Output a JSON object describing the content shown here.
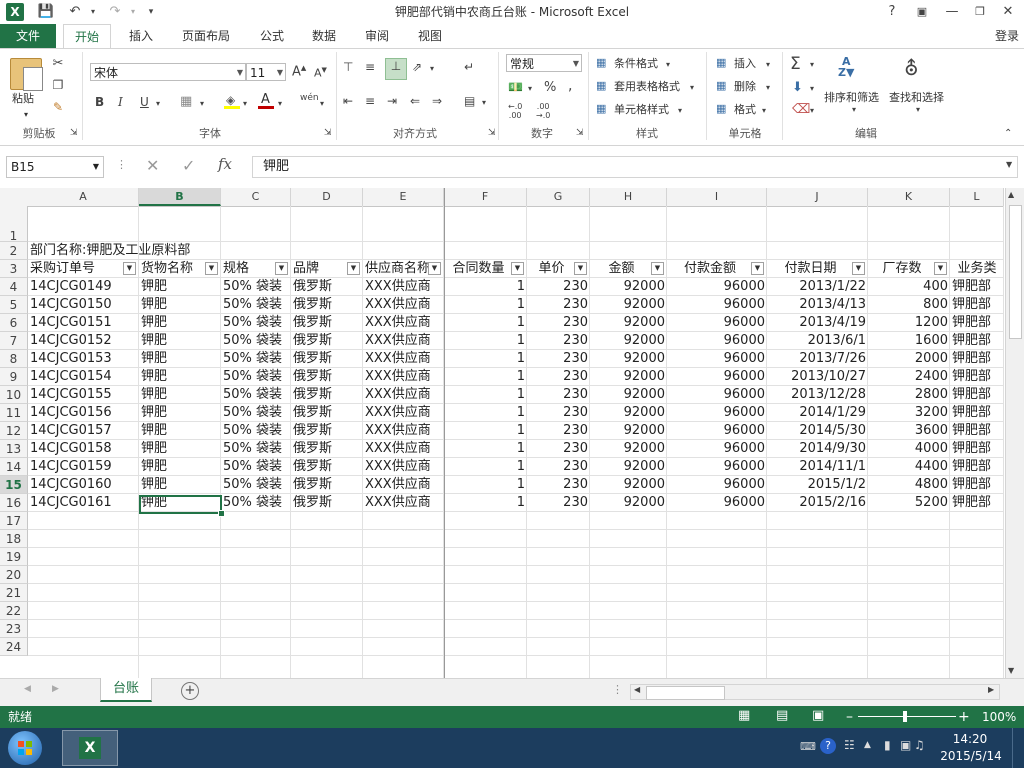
{
  "window": {
    "title": "钾肥部代销中农商丘台账 - Microsoft Excel",
    "help": "?",
    "login": "登录"
  },
  "tabs": [
    {
      "label": "文件"
    },
    {
      "label": "开始"
    },
    {
      "label": "插入"
    },
    {
      "label": "页面布局"
    },
    {
      "label": "公式"
    },
    {
      "label": "数据"
    },
    {
      "label": "审阅"
    },
    {
      "label": "视图"
    }
  ],
  "ribbon": {
    "clipboard": {
      "label": "剪贴板",
      "paste": "粘贴"
    },
    "font": {
      "label": "字体",
      "name": "宋体",
      "size": "11",
      "bold": "B",
      "italic": "I",
      "underline": "U",
      "wen": "wén"
    },
    "alignment": {
      "label": "对齐方式"
    },
    "number": {
      "label": "数字",
      "format": "常规"
    },
    "styles": {
      "label": "样式",
      "conditional": "条件格式",
      "table": "套用表格格式",
      "cell_styles": "单元格样式"
    },
    "cells": {
      "label": "单元格",
      "insert": "插入",
      "delete": "删除",
      "format": "格式"
    },
    "editing": {
      "label": "编辑",
      "sort_filter": "排序和筛选",
      "find_select": "查找和选择"
    }
  },
  "formula_bar": {
    "name_box": "B15",
    "fx": "fx",
    "content": "钾肥"
  },
  "columns": [
    "A",
    "B",
    "C",
    "D",
    "E",
    "F",
    "G",
    "H",
    "I",
    "J",
    "K",
    "L"
  ],
  "row_numbers": [
    "1",
    "2",
    "3",
    "4",
    "5",
    "6",
    "7",
    "8",
    "9",
    "10",
    "11",
    "12",
    "13",
    "14",
    "15",
    "16",
    "17",
    "18",
    "19",
    "20",
    "21",
    "22",
    "23",
    "24"
  ],
  "dept_label": "部门名称:钾肥及工业原料部",
  "headers": [
    "采购订单号",
    "货物名称",
    "规格",
    "品牌",
    "供应商名称",
    "合同数量",
    "单价",
    "金额",
    "付款金额",
    "付款日期",
    "厂存数",
    "业务类"
  ],
  "rows": [
    [
      "14CJCG0149",
      "钾肥",
      "50% 袋装",
      "俄罗斯",
      "XXX供应商",
      "1",
      "230",
      "92000",
      "96000",
      "2013/1/22",
      "400",
      "钾肥部"
    ],
    [
      "14CJCG0150",
      "钾肥",
      "50% 袋装",
      "俄罗斯",
      "XXX供应商",
      "1",
      "230",
      "92000",
      "96000",
      "2013/4/13",
      "800",
      "钾肥部"
    ],
    [
      "14CJCG0151",
      "钾肥",
      "50% 袋装",
      "俄罗斯",
      "XXX供应商",
      "1",
      "230",
      "92000",
      "96000",
      "2013/4/19",
      "1200",
      "钾肥部"
    ],
    [
      "14CJCG0152",
      "钾肥",
      "50% 袋装",
      "俄罗斯",
      "XXX供应商",
      "1",
      "230",
      "92000",
      "96000",
      "2013/6/1",
      "1600",
      "钾肥部"
    ],
    [
      "14CJCG0153",
      "钾肥",
      "50% 袋装",
      "俄罗斯",
      "XXX供应商",
      "1",
      "230",
      "92000",
      "96000",
      "2013/7/26",
      "2000",
      "钾肥部"
    ],
    [
      "14CJCG0154",
      "钾肥",
      "50% 袋装",
      "俄罗斯",
      "XXX供应商",
      "1",
      "230",
      "92000",
      "96000",
      "2013/10/27",
      "2400",
      "钾肥部"
    ],
    [
      "14CJCG0155",
      "钾肥",
      "50% 袋装",
      "俄罗斯",
      "XXX供应商",
      "1",
      "230",
      "92000",
      "96000",
      "2013/12/28",
      "2800",
      "钾肥部"
    ],
    [
      "14CJCG0156",
      "钾肥",
      "50% 袋装",
      "俄罗斯",
      "XXX供应商",
      "1",
      "230",
      "92000",
      "96000",
      "2014/1/29",
      "3200",
      "钾肥部"
    ],
    [
      "14CJCG0157",
      "钾肥",
      "50% 袋装",
      "俄罗斯",
      "XXX供应商",
      "1",
      "230",
      "92000",
      "96000",
      "2014/5/30",
      "3600",
      "钾肥部"
    ],
    [
      "14CJCG0158",
      "钾肥",
      "50% 袋装",
      "俄罗斯",
      "XXX供应商",
      "1",
      "230",
      "92000",
      "96000",
      "2014/9/30",
      "4000",
      "钾肥部"
    ],
    [
      "14CJCG0159",
      "钾肥",
      "50% 袋装",
      "俄罗斯",
      "XXX供应商",
      "1",
      "230",
      "92000",
      "96000",
      "2014/11/1",
      "4400",
      "钾肥部"
    ],
    [
      "14CJCG0160",
      "钾肥",
      "50% 袋装",
      "俄罗斯",
      "XXX供应商",
      "1",
      "230",
      "92000",
      "96000",
      "2015/1/2",
      "4800",
      "钾肥部"
    ],
    [
      "14CJCG0161",
      "钾肥",
      "50% 袋装",
      "俄罗斯",
      "XXX供应商",
      "1",
      "230",
      "92000",
      "96000",
      "2015/2/16",
      "5200",
      "钾肥部"
    ]
  ],
  "sheet_tab": "台账",
  "status": {
    "ready": "就绪",
    "zoom": "100%"
  },
  "taskbar": {
    "time": "14:20",
    "date": "2015/5/14"
  },
  "colors": {
    "excel_green": "#217346",
    "taskbar": "#1c3d5e"
  }
}
